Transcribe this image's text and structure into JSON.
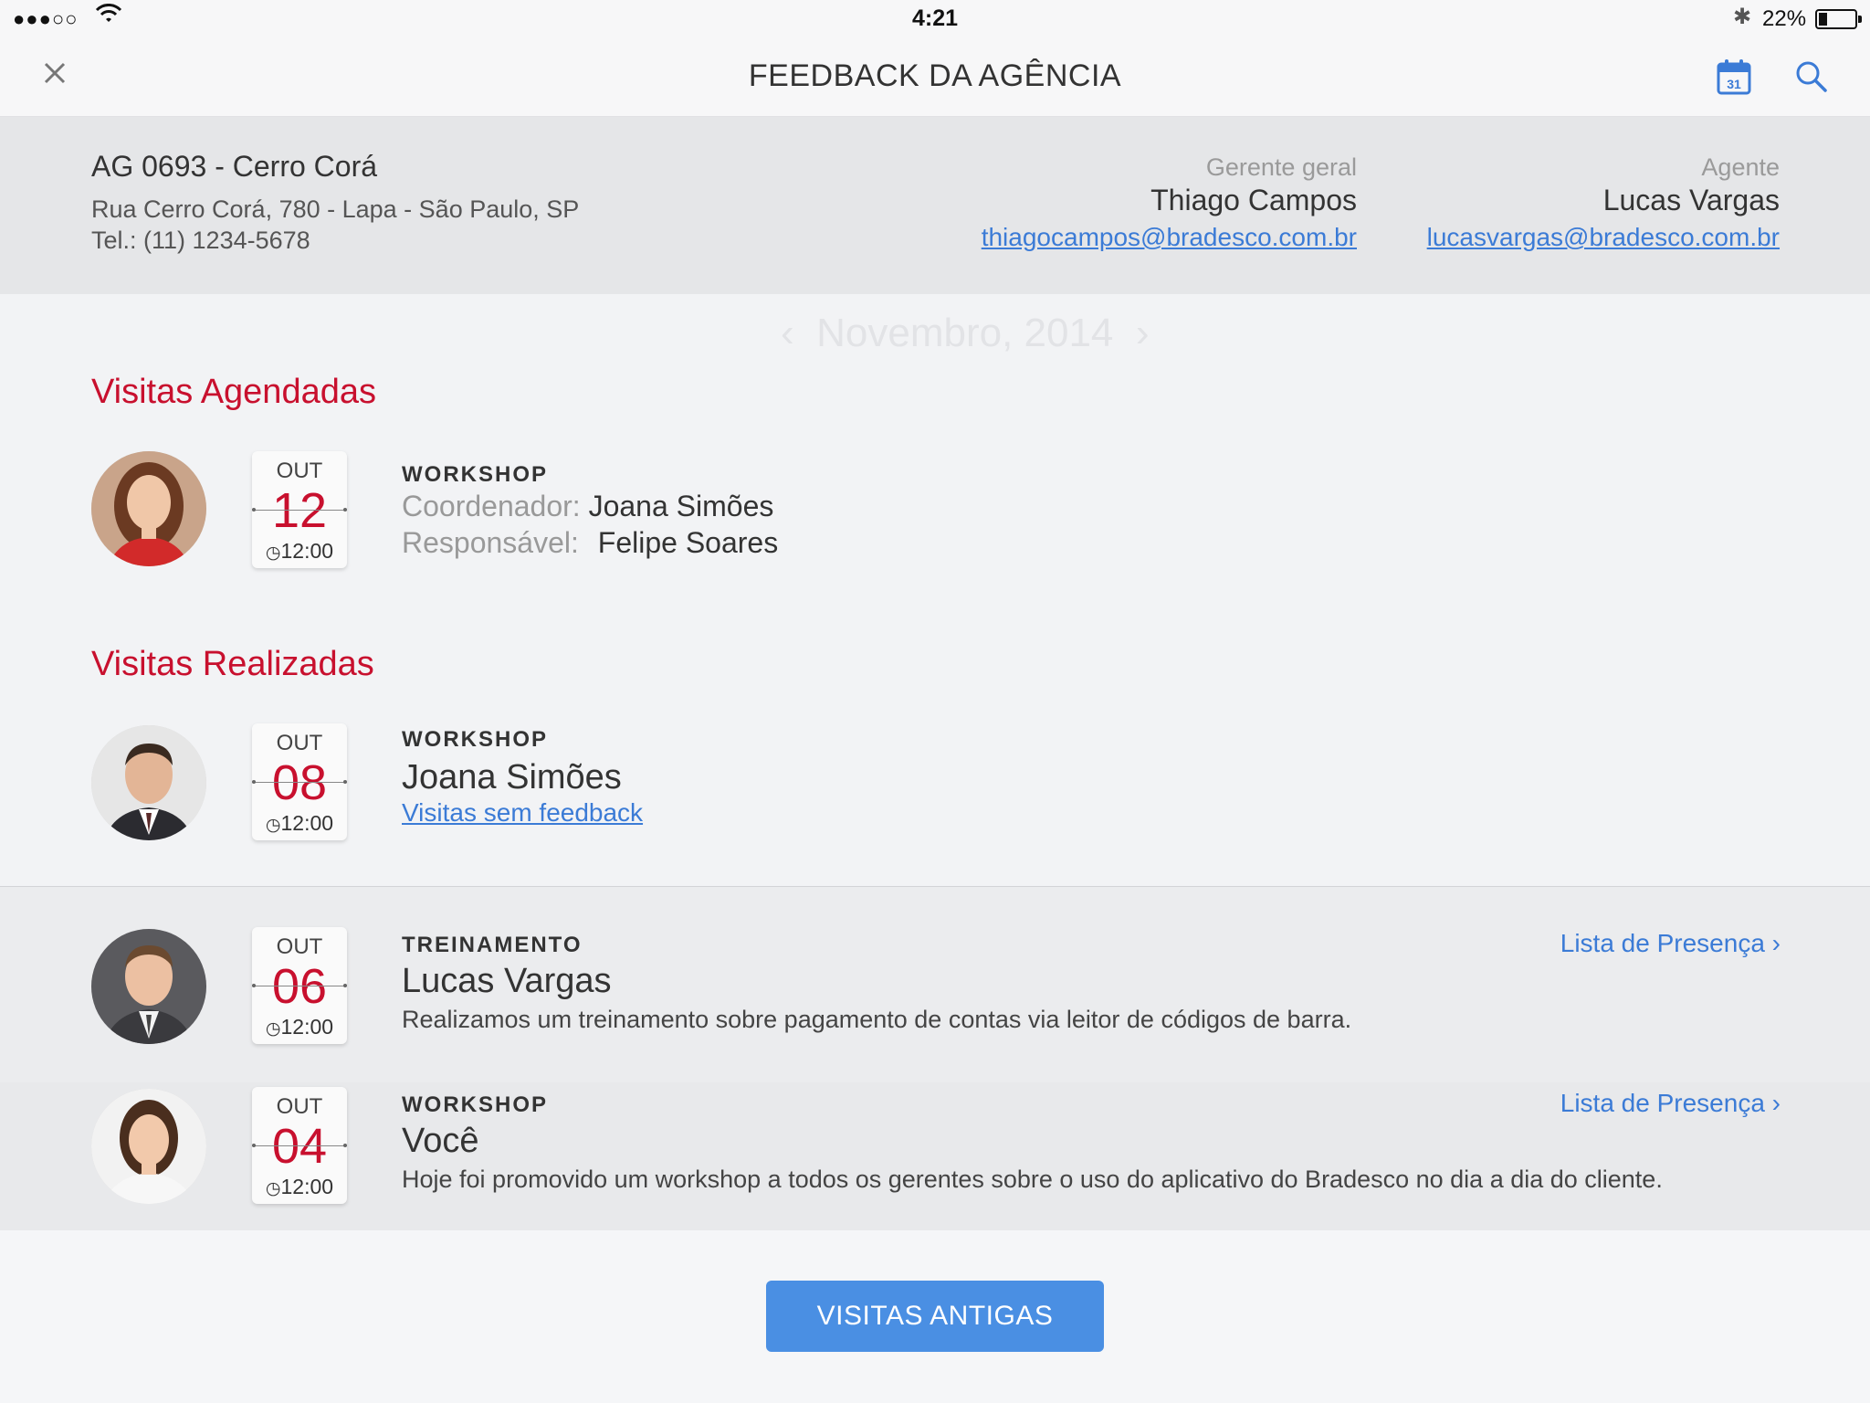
{
  "status_bar": {
    "signal": "●●●○○",
    "time": "4:21",
    "battery_pct": "22%",
    "battery_level": 0.22
  },
  "nav": {
    "title": "FEEDBACK DA AGÊNCIA",
    "close_icon": "close-icon",
    "calendar_icon": "calendar-icon",
    "calendar_day": "31",
    "search_icon": "search-icon"
  },
  "agency": {
    "name": "AG 0693 - Cerro Corá",
    "address": "Rua Cerro Corá, 780 - Lapa - São Paulo, SP",
    "phone": "Tel.: (11) 1234-5678",
    "manager": {
      "role": "Gerente geral",
      "name": "Thiago Campos",
      "email": "thiagocampos@bradesco.com.br"
    },
    "agent": {
      "role": "Agente",
      "name": "Lucas Vargas",
      "email": "lucasvargas@bradesco.com.br"
    }
  },
  "scheduled": {
    "title": "Visitas Agendadas",
    "items": [
      {
        "month": "OUT",
        "day": "12",
        "time": "12:00",
        "type": "WORKSHOP",
        "coord_label": "Coordenador:",
        "coord_name": "Joana Simões",
        "resp_label": "Responsável:",
        "resp_name": "Felipe Soares"
      }
    ]
  },
  "completed": {
    "title": "Visitas Realizadas",
    "items": [
      {
        "month": "OUT",
        "day": "08",
        "time": "12:00",
        "type": "WORKSHOP",
        "person": "Joana Simões",
        "link": "Visitas sem feedback"
      },
      {
        "month": "OUT",
        "day": "06",
        "time": "12:00",
        "type": "TREINAMENTO",
        "person": "Lucas Vargas",
        "description": "Realizamos um treinamento sobre  pagamento de contas via leitor de códigos de barra.",
        "presence": "Lista de Presença"
      },
      {
        "month": "OUT",
        "day": "04",
        "time": "12:00",
        "type": "WORKSHOP",
        "person": "Você",
        "description": "Hoje foi promovido um workshop a todos os gerentes sobre o uso do aplicativo do Bradesco no dia a dia do cliente.",
        "presence": "Lista de Presença"
      }
    ]
  },
  "footer": {
    "old_visits": "VISITAS ANTIGAS"
  },
  "colors": {
    "accent_red": "#c8102e",
    "link_blue": "#3b7bd6",
    "button_blue": "#4a8fe3"
  }
}
